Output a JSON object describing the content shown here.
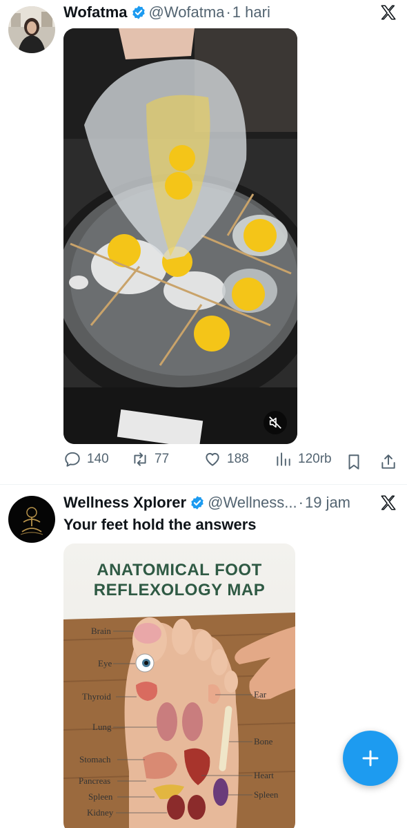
{
  "posts": [
    {
      "author": "Wofatma",
      "handle": "@Wofatma",
      "time": "1 hari",
      "stats": {
        "replies": "140",
        "reposts": "77",
        "likes": "188",
        "views": "120rb"
      }
    },
    {
      "author": "Wellness Xplorer",
      "handle": "@Wellness...",
      "time": "19 jam",
      "text": "Your feet hold the answers",
      "image": {
        "title_line1": "ANATOMICAL FOOT",
        "title_line2": "REFLEXOLOGY MAP",
        "labels_left": [
          "Brain",
          "Eye",
          "Thyroid",
          "Lung",
          "Stomach",
          "Pancreas",
          "Spleen",
          "Kidney"
        ],
        "labels_right": [
          "Ear",
          "Bone",
          "Heart",
          "Spleen"
        ]
      }
    }
  ],
  "colors": {
    "accent": "#1d9bf0",
    "verified": "#1d9bf0",
    "secondary_text": "#536471"
  },
  "icons": [
    "verified-icon",
    "x-logo-icon",
    "reply-icon",
    "repost-icon",
    "like-icon",
    "views-icon",
    "bookmark-icon",
    "share-icon",
    "mute-icon",
    "plus-icon"
  ]
}
